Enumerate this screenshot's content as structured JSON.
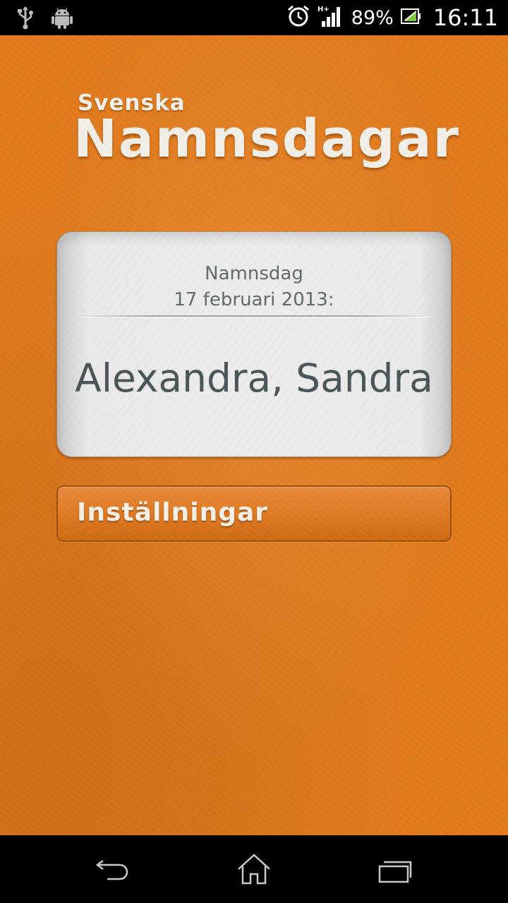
{
  "status_bar": {
    "left_icons": [
      "usb-icon",
      "android-debug-icon"
    ],
    "right_icons": [
      "alarm-icon",
      "signal-hplus-icon",
      "battery-charging-icon"
    ],
    "battery_percent": "89%",
    "time": "16:11"
  },
  "app": {
    "logo_small": "Svenska",
    "logo_big": "Namnsdagar",
    "card": {
      "label_line1": "Namnsdag",
      "label_line2": "17 februari 2013:",
      "names": "Alexandra, Sandra"
    },
    "settings_button_label": "Inställningar",
    "colors": {
      "background": "#e07a1d",
      "card": "#ececec",
      "card_text": "#4a5557",
      "logo_text": "#f1eee8"
    }
  },
  "nav_bar": {
    "buttons": [
      "back-icon",
      "home-icon",
      "recent-apps-icon"
    ]
  }
}
